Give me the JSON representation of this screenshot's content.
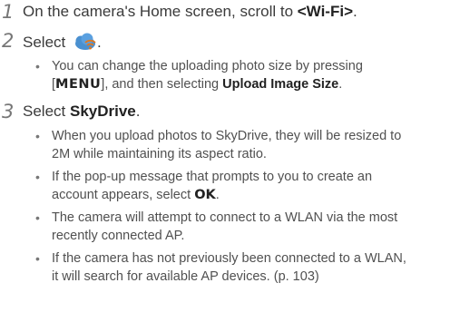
{
  "steps": [
    {
      "number": "1",
      "prefix": "On the camera's Home screen, scroll to ",
      "bold": "<Wi-Fi>",
      "suffix": "."
    },
    {
      "number": "2",
      "prefix": "Select ",
      "icon": "wifi-cloud-icon",
      "suffix": ".",
      "bullets": [
        {
          "line1_pre": "You can change the uploading photo size by pressing",
          "bracket_open": "[",
          "key": "MENU",
          "bracket_close": "]",
          "mid": ", and then selecting ",
          "bold": "Upload Image Size",
          "end": "."
        }
      ]
    },
    {
      "number": "3",
      "prefix": "Select ",
      "bold": "SkyDrive",
      "suffix": ".",
      "bullets": [
        {
          "line1": "When you upload photos to SkyDrive, they will be resized to",
          "line2": "2M while maintaining its aspect ratio."
        },
        {
          "line1": "If the pop-up message that prompts to you to create an",
          "line2_pre": "account appears, select ",
          "key": "OK",
          "end": "."
        },
        {
          "line1": "The camera will attempt to connect to a WLAN via the most",
          "line2": "recently connected AP."
        },
        {
          "line1": "If the camera has not previously been connected to a WLAN,",
          "line2": "it will search for available AP devices. (p. 103)"
        }
      ]
    }
  ],
  "colors": {
    "text": "#3a3a3a",
    "bullet_text": "#505050",
    "step_number": "#777777",
    "icon_cloud": "#4a90d0",
    "icon_signal": "#e07820"
  }
}
